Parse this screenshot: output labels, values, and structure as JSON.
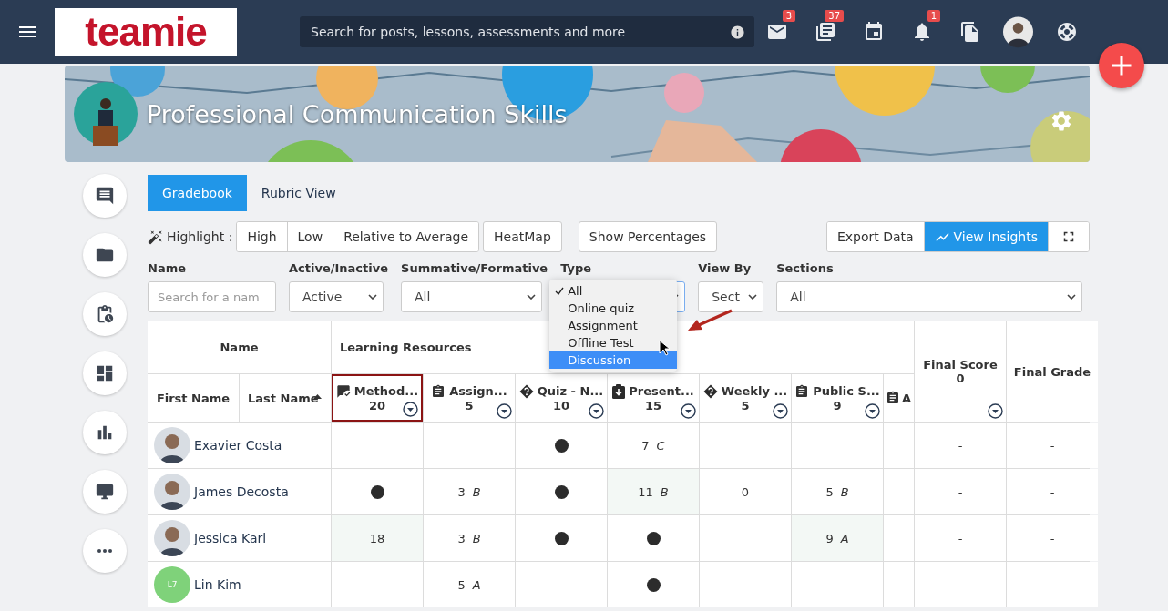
{
  "nav": {
    "logo": "teamie",
    "search": {
      "placeholder": "Search for posts, lessons, assessments and more"
    },
    "icons": [
      {
        "kind": "mail",
        "badge": "3"
      },
      {
        "kind": "news",
        "badge": "37"
      },
      {
        "kind": "calendar"
      },
      {
        "kind": "bell",
        "badge": "1"
      },
      {
        "kind": "docs"
      },
      {
        "kind": "avatar"
      },
      {
        "kind": "help"
      }
    ]
  },
  "course": {
    "title": "Professional Communication Skills"
  },
  "sidebar": [
    {
      "kind": "chat"
    },
    {
      "kind": "folder"
    },
    {
      "kind": "schedule"
    },
    {
      "kind": "dashboard"
    },
    {
      "kind": "chart"
    },
    {
      "kind": "monitor"
    },
    {
      "kind": "more"
    }
  ],
  "tabs": [
    {
      "label": "Gradebook",
      "selected": true
    },
    {
      "label": "Rubric View",
      "selected": false
    }
  ],
  "highlight": {
    "label": "Highlight :",
    "options": [
      "High",
      "Low",
      "Relative to Average"
    ],
    "heatmap": "HeatMap",
    "percentages": "Show Percentages"
  },
  "actions": [
    {
      "kind": "text",
      "label": "Export Data",
      "selected": false
    },
    {
      "kind": "insights",
      "label": "View Insights",
      "selected": true
    },
    {
      "kind": "fullscreen",
      "selected": false
    }
  ],
  "filters": [
    {
      "label": "Name",
      "kind": "text",
      "placeholder": "Search for a nam"
    },
    {
      "label": "Active/Inactive",
      "kind": "select",
      "value": "Active"
    },
    {
      "label": "Summative/Formative",
      "kind": "select",
      "value": "All"
    },
    {
      "label": "Type",
      "kind": "select",
      "menu": [
        {
          "label": "All",
          "selected": true,
          "hovered": false
        },
        {
          "label": "Online quiz",
          "selected": false,
          "hovered": false
        },
        {
          "label": "Assignment",
          "selected": false,
          "hovered": false
        },
        {
          "label": "Offline Test",
          "selected": false,
          "hovered": false
        },
        {
          "label": "Discussion",
          "selected": false,
          "hovered": true
        }
      ]
    },
    {
      "label": "View By",
      "kind": "select",
      "value": "Sect"
    },
    {
      "label": "Sections",
      "kind": "select",
      "value": "All"
    }
  ],
  "table": {
    "name_header": "Name",
    "first_name": "First Name",
    "last_name": {
      "label": "Last Name",
      "sorted": true
    },
    "group": "Learning Resources",
    "columns": [
      {
        "title": "Method...",
        "points": "20",
        "kind": "discussion",
        "outlined": true,
        "partial": false
      },
      {
        "title": "Assign...",
        "points": "5",
        "kind": "assignment",
        "outlined": false,
        "partial": false
      },
      {
        "title": "Quiz - N...",
        "points": "10",
        "kind": "quiz",
        "outlined": false,
        "partial": false
      },
      {
        "title": "Present...",
        "points": "15",
        "kind": "presentation",
        "outlined": false,
        "partial": false
      },
      {
        "title": "Weekly ...",
        "points": "5",
        "kind": "quiz",
        "outlined": false,
        "partial": false
      },
      {
        "title": "Public S...",
        "points": "9",
        "kind": "assignment",
        "outlined": false,
        "partial": false
      },
      {
        "title": "A",
        "kind": "assignment",
        "outlined": false,
        "partial": true
      }
    ],
    "final_score": {
      "label": "Final Score",
      "value": "0"
    },
    "final_grade": "Final Grade",
    "rows": [
      {
        "name": "Exavier Costa",
        "final_score": "-",
        "final_grade": "-",
        "cells": [
          {
            "kind": "empty",
            "highlighted": false
          },
          {
            "kind": "empty",
            "highlighted": false
          },
          {
            "kind": "dot",
            "highlighted": false
          },
          {
            "kind": "score",
            "score": "7",
            "grade": "C",
            "highlighted": false
          },
          {
            "kind": "empty",
            "highlighted": false
          },
          {
            "kind": "empty",
            "highlighted": false
          },
          {
            "kind": "empty",
            "highlighted": false
          }
        ]
      },
      {
        "name": "James Decosta",
        "final_score": "-",
        "final_grade": "-",
        "cells": [
          {
            "kind": "dot",
            "highlighted": false
          },
          {
            "kind": "score",
            "score": "3",
            "grade": "B",
            "highlighted": false
          },
          {
            "kind": "dot",
            "highlighted": false
          },
          {
            "kind": "score",
            "score": "11",
            "grade": "B",
            "highlighted": true
          },
          {
            "kind": "score",
            "score": "0",
            "highlighted": false
          },
          {
            "kind": "score",
            "score": "5",
            "grade": "B",
            "highlighted": false
          },
          {
            "kind": "empty",
            "highlighted": false
          }
        ]
      },
      {
        "name": "Jessica Karl",
        "final_score": "-",
        "final_grade": "-",
        "cells": [
          {
            "kind": "score",
            "score": "18",
            "highlighted": true
          },
          {
            "kind": "score",
            "score": "3",
            "grade": "B",
            "highlighted": false
          },
          {
            "kind": "dot",
            "highlighted": false
          },
          {
            "kind": "dot",
            "highlighted": false
          },
          {
            "kind": "empty",
            "highlighted": false
          },
          {
            "kind": "score",
            "score": "9",
            "grade": "A",
            "highlighted": true
          },
          {
            "kind": "empty",
            "highlighted": false
          }
        ]
      },
      {
        "name": "Lin Kim",
        "avatar": {
          "kind": "initials",
          "text": "L7"
        },
        "final_score": "-",
        "final_grade": "-",
        "cells": [
          {
            "kind": "empty",
            "highlighted": false
          },
          {
            "kind": "score",
            "score": "5",
            "grade": "A",
            "highlighted": false
          },
          {
            "kind": "empty",
            "highlighted": false
          },
          {
            "kind": "dot",
            "highlighted": false
          },
          {
            "kind": "empty",
            "highlighted": false
          },
          {
            "kind": "empty",
            "highlighted": false
          },
          {
            "kind": "empty",
            "highlighted": false
          }
        ]
      }
    ]
  }
}
